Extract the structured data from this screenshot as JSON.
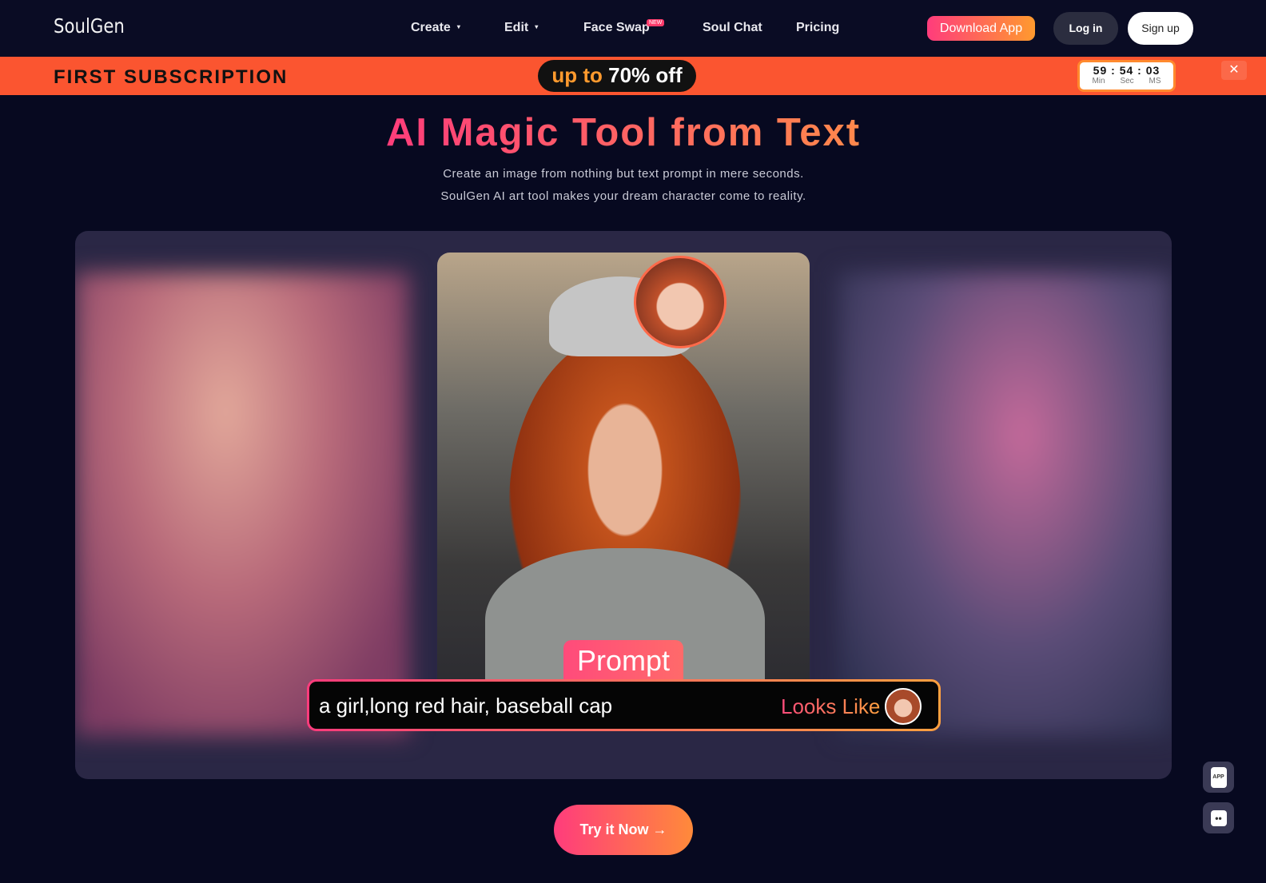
{
  "nav": {
    "logo": "SoulGen",
    "items": [
      {
        "label": "Create",
        "caret": "▾"
      },
      {
        "label": "Edit",
        "caret": "▾"
      },
      {
        "label": "Face Swap",
        "badge": "NEW"
      },
      {
        "label": "Soul Chat"
      },
      {
        "label": "Pricing"
      }
    ],
    "download": "Download App",
    "login": "Log in",
    "signup": "Sign up"
  },
  "promo": {
    "title": "FIRST SUBSCRIPTION",
    "pill_prefix": "up to",
    "pill_value": "70% off",
    "timer": {
      "min": "59",
      "sec": "54",
      "ms": "03",
      "sep": ":",
      "min_label": "Min",
      "sec_label": "Sec",
      "ms_label": "MS"
    },
    "close": "✕"
  },
  "hero": {
    "title": "AI Magic Tool from Text",
    "line1": "Create an image from nothing but text prompt in mere seconds.",
    "line2": "SoulGen AI art tool makes your dream character come to reality."
  },
  "showcase": {
    "prompt_tag": "Prompt",
    "prompt_text": "a girl,long red hair, baseball cap",
    "looks_like": "Looks Like"
  },
  "cta": {
    "label": "Try it Now",
    "arrow": "→"
  },
  "floating": {
    "app_label": "APP",
    "chat_icon": "••"
  },
  "colors": {
    "accent_start": "#ff3c7c",
    "accent_end": "#ff9a2e",
    "promo_bg": "#fb5530",
    "bg": "#070920"
  }
}
